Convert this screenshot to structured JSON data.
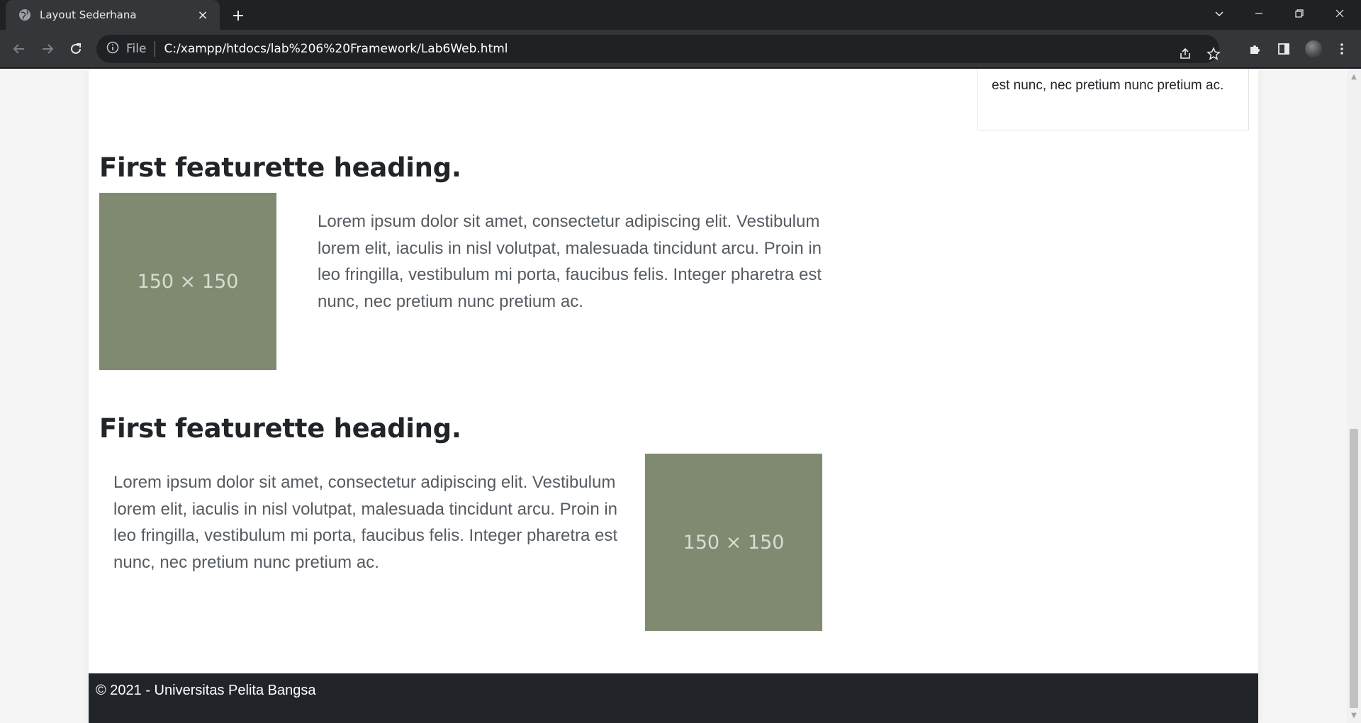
{
  "browser": {
    "tab_title": "Layout Sederhana",
    "close_tab_glyph": "×",
    "new_tab_glyph": "+",
    "site_info_label": "File",
    "url": "C:/xampp/htdocs/lab%206%20Framework/Lab6Web.html",
    "icons": [
      "globe-icon",
      "close-icon",
      "plus-icon",
      "chevron-down-icon",
      "minimize-icon",
      "restore-icon",
      "window-close-icon",
      "back-icon",
      "forward-icon",
      "reload-icon",
      "info-icon",
      "share-icon",
      "star-icon",
      "extensions-icon",
      "side-panel-icon",
      "profile-avatar",
      "menu-icon"
    ],
    "theme": {
      "frame": "#202124",
      "toolbar": "#35363a",
      "omnibox": "#202124",
      "text": "#e8eaed"
    }
  },
  "page": {
    "sidebar_text": "est nunc, nec pretium nunc pretium ac.",
    "featurettes": [
      {
        "heading": "First featurette heading.",
        "image_label": "150 × 150",
        "text": "Lorem ipsum dolor sit amet, consectetur adipiscing elit. Vestibulum lorem elit, iaculis in nisl volutpat, malesuada tincidunt arcu. Proin in leo fringilla, vestibulum mi porta, faucibus felis. Integer pharetra est nunc, nec pretium nunc pretium ac."
      },
      {
        "heading": "First featurette heading.",
        "image_label": "150 × 150",
        "text": "Lorem ipsum dolor sit amet, consectetur adipiscing elit. Vestibulum lorem elit, iaculis in nisl volutpat, malesuada tincidunt arcu. Proin in leo fringilla, vestibulum mi porta, faucibus felis. Integer pharetra est nunc, nec pretium nunc pretium ac."
      }
    ],
    "footer": "© 2021 - Universitas Pelita Bangsa",
    "colors": {
      "placeholder": "#7f8a71",
      "footer": "#212529",
      "heading": "#212529",
      "body_text": "#555b61"
    }
  }
}
